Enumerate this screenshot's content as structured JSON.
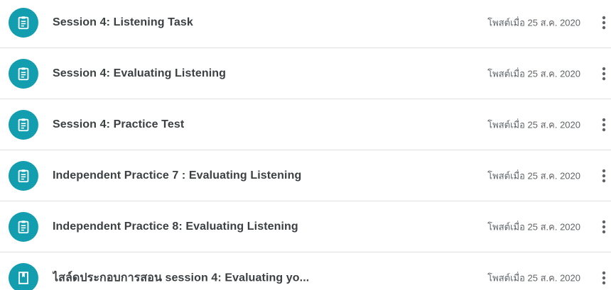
{
  "accent_color": "#129eaf",
  "items": [
    {
      "icon": "assignment-icon",
      "title": "Session 4: Listening Task",
      "date": "โพสต์เมื่อ 25 ส.ค. 2020"
    },
    {
      "icon": "assignment-icon",
      "title": "Session 4: Evaluating Listening",
      "date": "โพสต์เมื่อ 25 ส.ค. 2020"
    },
    {
      "icon": "assignment-icon",
      "title": "Session 4: Practice Test",
      "date": "โพสต์เมื่อ 25 ส.ค. 2020"
    },
    {
      "icon": "assignment-icon",
      "title": "Independent Practice 7 : Evaluating Listening",
      "date": "โพสต์เมื่อ 25 ส.ค. 2020"
    },
    {
      "icon": "assignment-icon",
      "title": "Independent Practice 8: Evaluating Listening",
      "date": "โพสต์เมื่อ 25 ส.ค. 2020"
    },
    {
      "icon": "material-icon",
      "title": "ไสล์ดประกอบการสอน session 4: Evaluating yo...",
      "date": "โพสต์เมื่อ 25 ส.ค. 2020"
    }
  ]
}
